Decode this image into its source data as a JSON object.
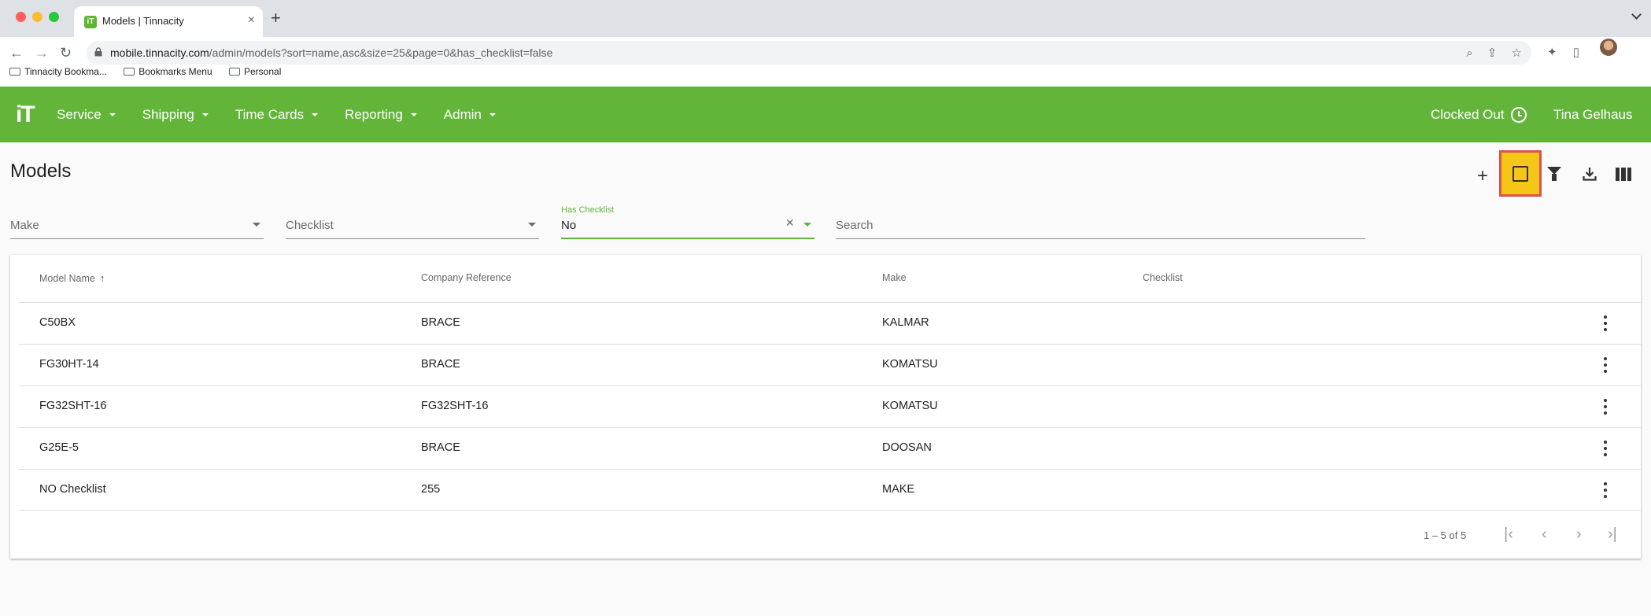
{
  "browser": {
    "tab_title": "Models | Tinnacity",
    "url_host": "mobile.tinnacity.com",
    "url_path": "/admin/models?sort=name,asc&size=25&page=0&has_checklist=false",
    "bookmarks": [
      "Tinnacity Bookma...",
      "Bookmarks Menu",
      "Personal"
    ]
  },
  "header": {
    "logo": "iT",
    "menu": [
      "Service",
      "Shipping",
      "Time Cards",
      "Reporting",
      "Admin"
    ],
    "clock_status": "Clocked Out",
    "user": "Tina Gelhaus",
    "accent_color": "#63b53a"
  },
  "page": {
    "title": "Models",
    "add_icon": "plus-icon",
    "toolbar_icons": [
      "plus-icon",
      "square-icon",
      "filter-icon",
      "download-icon",
      "columns-icon"
    ]
  },
  "filters": {
    "make_label": "Make",
    "checklist_label": "Checklist",
    "has_checklist_label": "Has Checklist",
    "has_checklist_value": "No",
    "search_placeholder": "Search"
  },
  "table": {
    "headers": [
      "Model Name",
      "Company Reference",
      "Make",
      "Checklist"
    ],
    "rows": [
      {
        "name": "C50BX",
        "ref": "BRACE",
        "make": "KALMAR",
        "checklist": ""
      },
      {
        "name": "FG30HT-14",
        "ref": "BRACE",
        "make": "KOMATSU",
        "checklist": ""
      },
      {
        "name": "FG32SHT-16",
        "ref": "FG32SHT-16",
        "make": "KOMATSU",
        "checklist": ""
      },
      {
        "name": "G25E-5",
        "ref": "BRACE",
        "make": "DOOSAN",
        "checklist": ""
      },
      {
        "name": "NO Checklist",
        "ref": "255",
        "make": "MAKE",
        "checklist": ""
      }
    ],
    "pagination": "1 – 5 of 5"
  }
}
